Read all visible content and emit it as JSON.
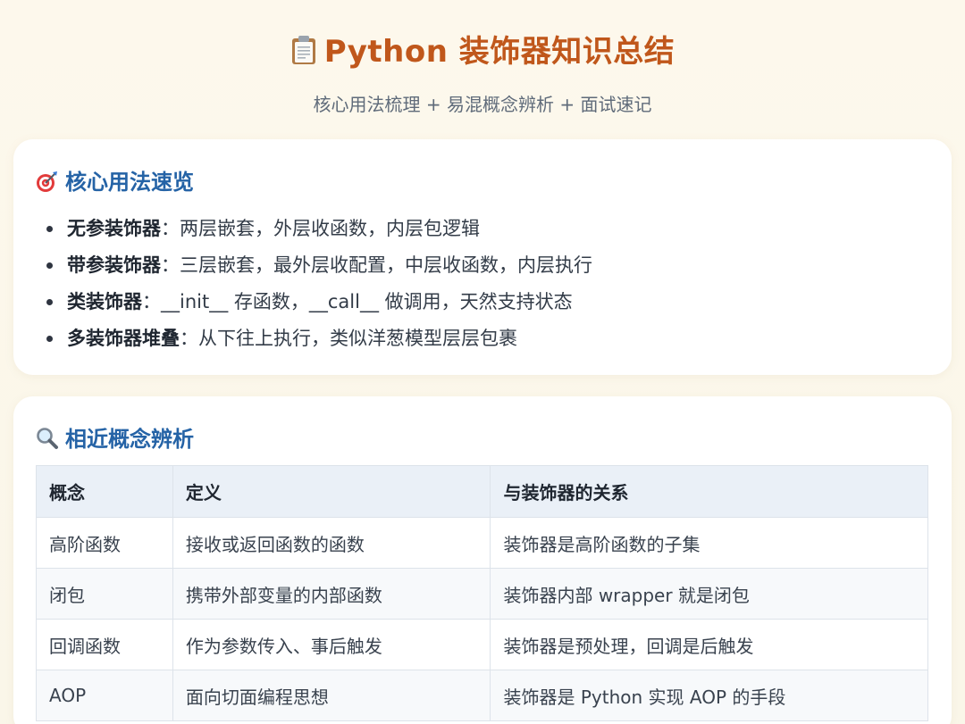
{
  "header": {
    "title_icon": "clipboard-icon",
    "title": "Python 装饰器知识总结",
    "subtitle": "核心用法梳理 + 易混概念辨析 + 面试速记"
  },
  "usage": {
    "icon": "target-icon",
    "title": "核心用法速览",
    "items": [
      {
        "term": "无参装饰器",
        "desc": "：两层嵌套，外层收函数，内层包逻辑"
      },
      {
        "term": "带参装饰器",
        "desc": "：三层嵌套，最外层收配置，中层收函数，内层执行"
      },
      {
        "term": "类装饰器",
        "desc": "：__init__ 存函数，__call__ 做调用，天然支持状态"
      },
      {
        "term": "多装饰器堆叠",
        "desc": "：从下往上执行，类似洋葱模型层层包裹"
      }
    ]
  },
  "concepts": {
    "icon": "magnifier-icon",
    "title": "相近概念辨析",
    "headers": [
      "概念",
      "定义",
      "与装饰器的关系"
    ],
    "rows": [
      [
        "高阶函数",
        "接收或返回函数的函数",
        "装饰器是高阶函数的子集"
      ],
      [
        "闭包",
        "携带外部变量的内部函数",
        "装饰器内部 wrapper 就是闭包"
      ],
      [
        "回调函数",
        "作为参数传入、事后触发",
        "装饰器是预处理，回调是后触发"
      ],
      [
        "AOP",
        "面向切面编程思想",
        "装饰器是 Python 实现 AOP 的手段"
      ]
    ]
  },
  "colors": {
    "title": "#c0571b",
    "section_title": "#2563a6",
    "background": "#fdf8ec",
    "table_header": "#eaf0f7"
  }
}
